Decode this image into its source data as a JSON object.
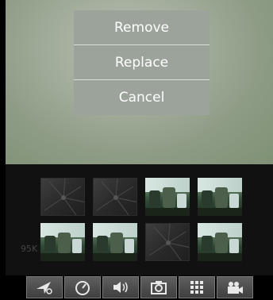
{
  "menu": {
    "remove_label": "Remove",
    "replace_label": "Replace",
    "cancel_label": "Cancel"
  },
  "gallery": {
    "thumbnails": [
      {
        "state": "empty"
      },
      {
        "state": "empty"
      },
      {
        "state": "photo"
      },
      {
        "state": "photo"
      },
      {
        "state": "photo"
      },
      {
        "state": "photo"
      },
      {
        "state": "empty"
      },
      {
        "state": "photo"
      }
    ],
    "size_label": "95K"
  },
  "toolbar": {
    "buttons": [
      {
        "icon": "send-settings-icon"
      },
      {
        "icon": "speedometer-icon"
      },
      {
        "icon": "volume-icon"
      },
      {
        "icon": "camera-icon"
      },
      {
        "icon": "grid-icon"
      },
      {
        "icon": "video-camera-icon"
      }
    ]
  },
  "colors": {
    "menu_bg": "#9ba39b",
    "panel_bg": "#111111",
    "toolbar_button": "#4f4f4f"
  }
}
